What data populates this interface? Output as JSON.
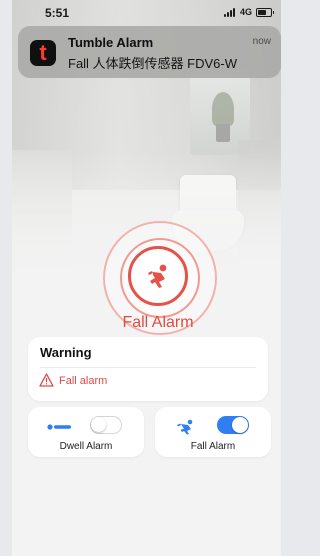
{
  "status_bar": {
    "time": "5:51",
    "network": "4G"
  },
  "notification": {
    "app_title": "Tumble Alarm",
    "message": "Fall 人体跌倒传感器 FDV6-W",
    "time": "now",
    "app_icon": "tuya-app-icon"
  },
  "alarm": {
    "label": "Fall Alarm",
    "icon": "person-falling-icon",
    "accent_color": "#e14a43"
  },
  "warning_card": {
    "title": "Warning",
    "message": "Fall alarm",
    "icon": "warning-triangle-icon"
  },
  "toggles": [
    {
      "label": "Dwell Alarm",
      "icon": "person-lying-icon",
      "enabled": false
    },
    {
      "label": "Fall Alarm",
      "icon": "person-falling-icon",
      "enabled": true
    }
  ],
  "colors": {
    "switch_on": "#2f7ff2",
    "icon_blue": "#2f7ff2",
    "alarm_red": "#e65148"
  }
}
